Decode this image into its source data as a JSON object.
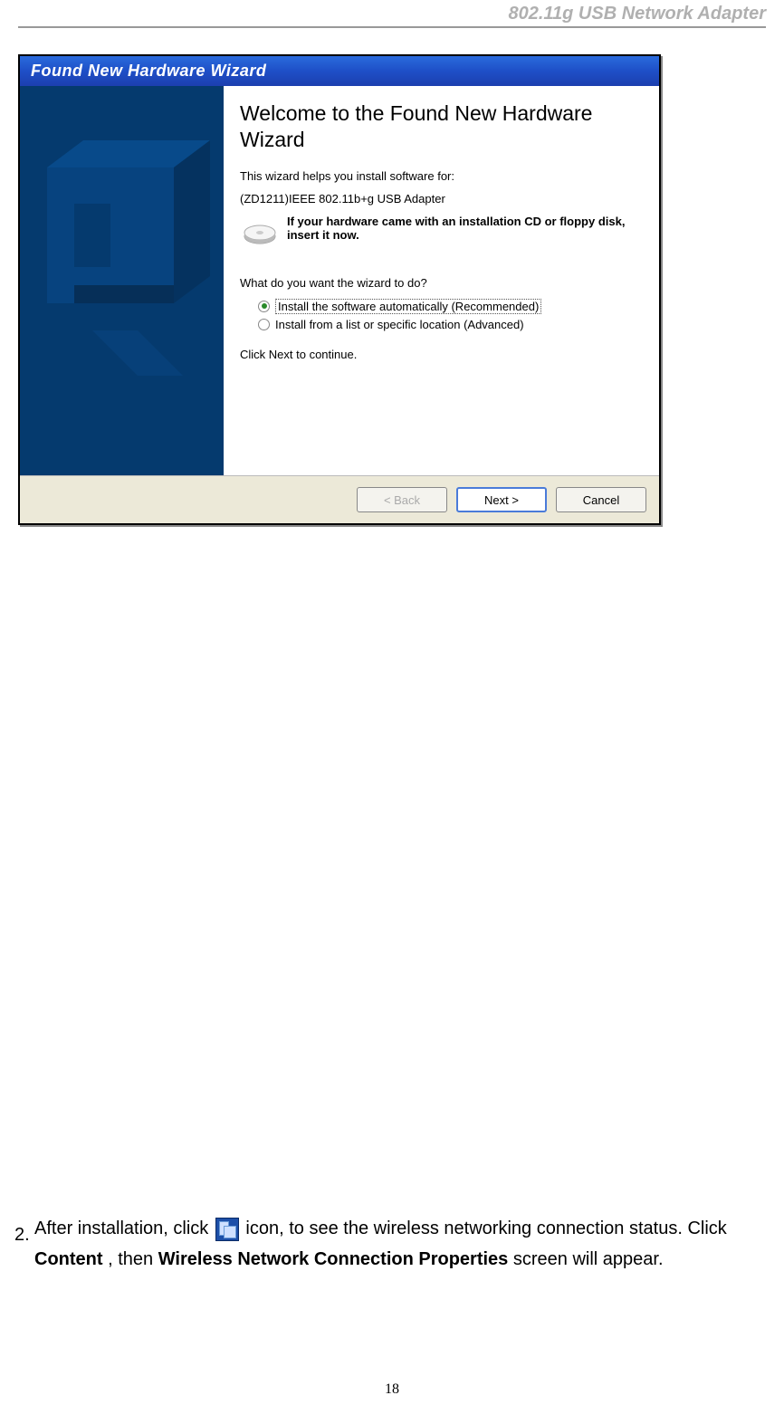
{
  "header": {
    "title": "802.11g USB Network Adapter"
  },
  "dialog": {
    "title": "Found New Hardware Wizard",
    "heading": "Welcome to the Found New Hardware Wizard",
    "intro": "This wizard helps you install software for:",
    "device": "(ZD1211)IEEE 802.11b+g USB Adapter",
    "cd_hint": "If your hardware came with an installation CD or floppy disk, insert it now.",
    "question": "What do you want the wizard to do?",
    "radio1": "Install the software automatically (Recommended)",
    "radio2": "Install from a list or specific location (Advanced)",
    "continue_hint": "Click Next to continue.",
    "buttons": {
      "back": "< Back",
      "next": "Next >",
      "cancel": "Cancel"
    }
  },
  "instruction": {
    "number": "2.",
    "part1": "After installation, click ",
    "part2": " icon, to see the wireless networking connection status. Click ",
    "bold1": "Content",
    "part3": ", then ",
    "bold2": "Wireless Network Connection Properties",
    "part4": " screen will appear."
  },
  "page_number": "18"
}
